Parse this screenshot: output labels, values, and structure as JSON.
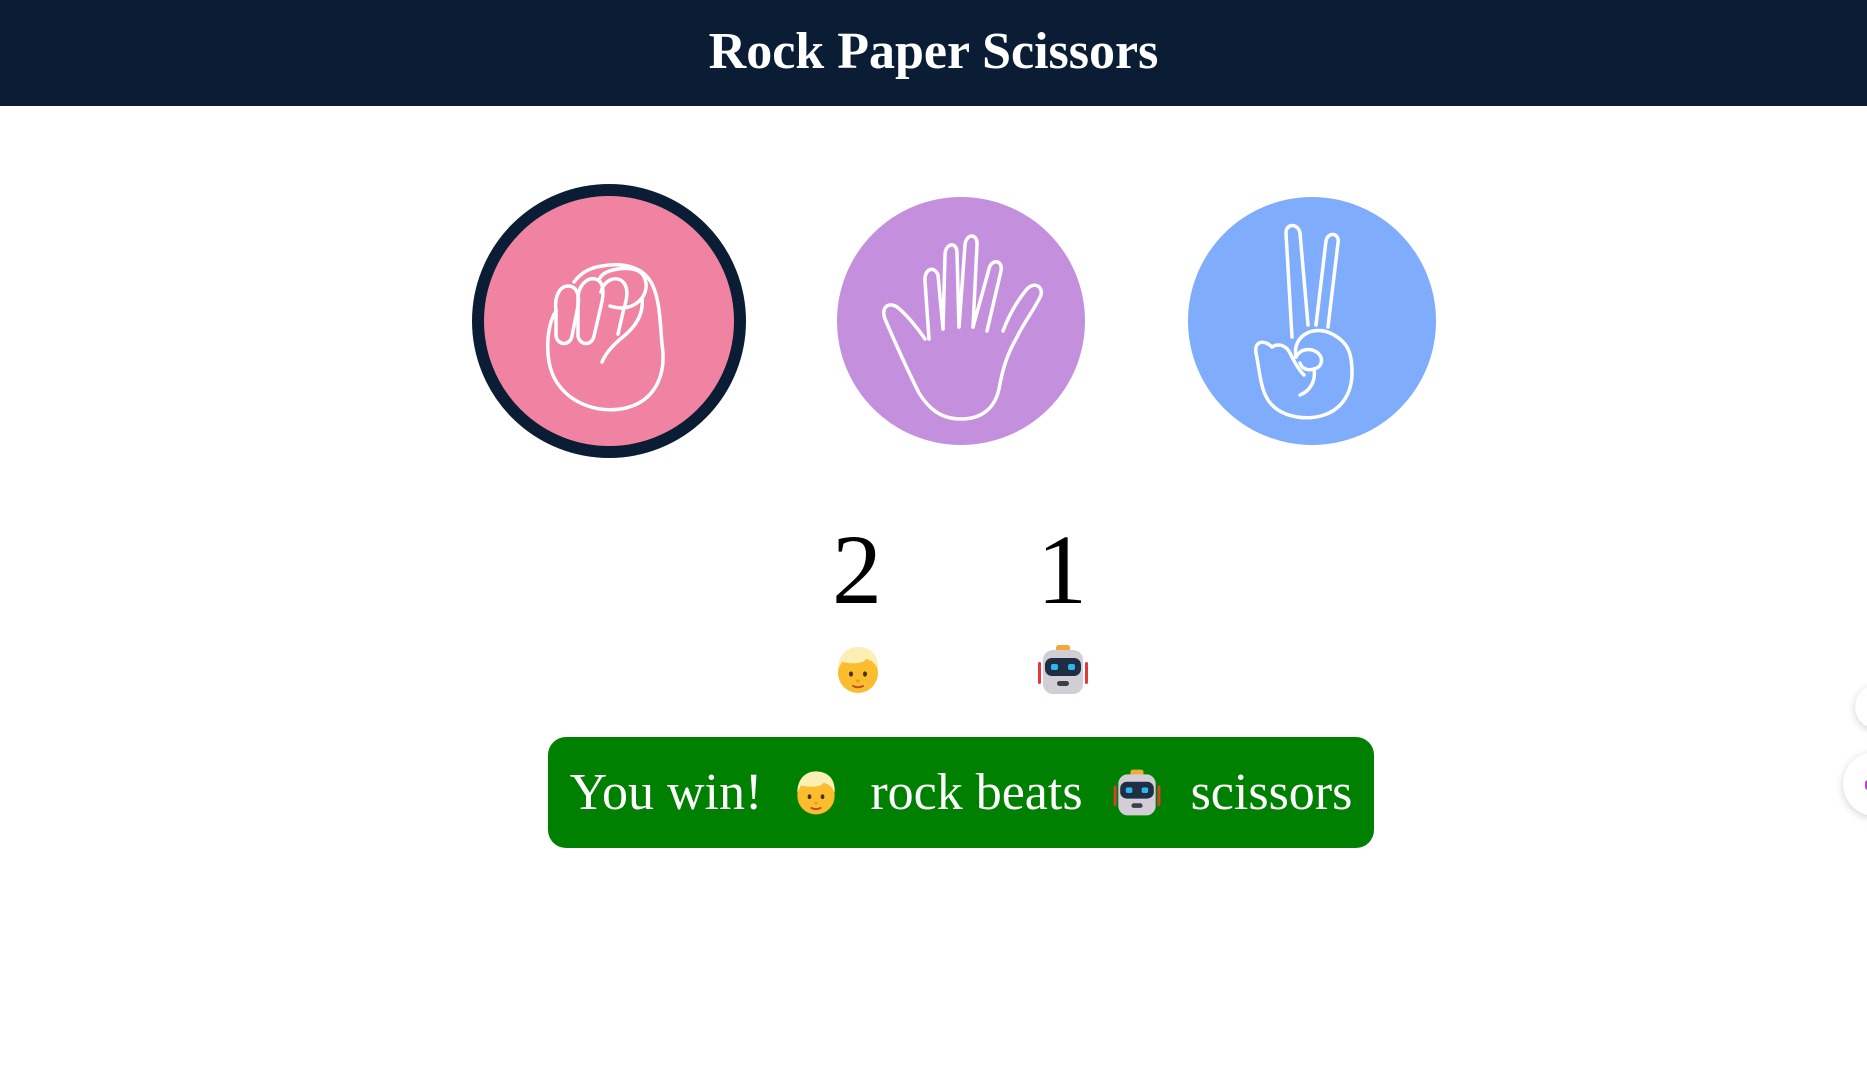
{
  "header": {
    "title": "Rock Paper Scissors"
  },
  "choices": [
    {
      "id": "rock",
      "icon": "fist-icon",
      "color": "#f083a1",
      "selected": true
    },
    {
      "id": "paper",
      "icon": "open-hand-icon",
      "color": "#c490de",
      "selected": false
    },
    {
      "id": "scissors",
      "icon": "victory-hand-icon",
      "color": "#80acfc",
      "selected": false
    }
  ],
  "scoreboard": {
    "player": {
      "score": "2",
      "icon": "person-face-icon"
    },
    "computer": {
      "score": "1",
      "icon": "robot-face-icon"
    }
  },
  "result": {
    "message": "You win!",
    "player_choice": "rock",
    "verb": "beats",
    "computer_choice": "scissors",
    "color": "#008000"
  },
  "colors": {
    "header_bg": "#0b1d35",
    "selected_border": "#0b1d35"
  }
}
